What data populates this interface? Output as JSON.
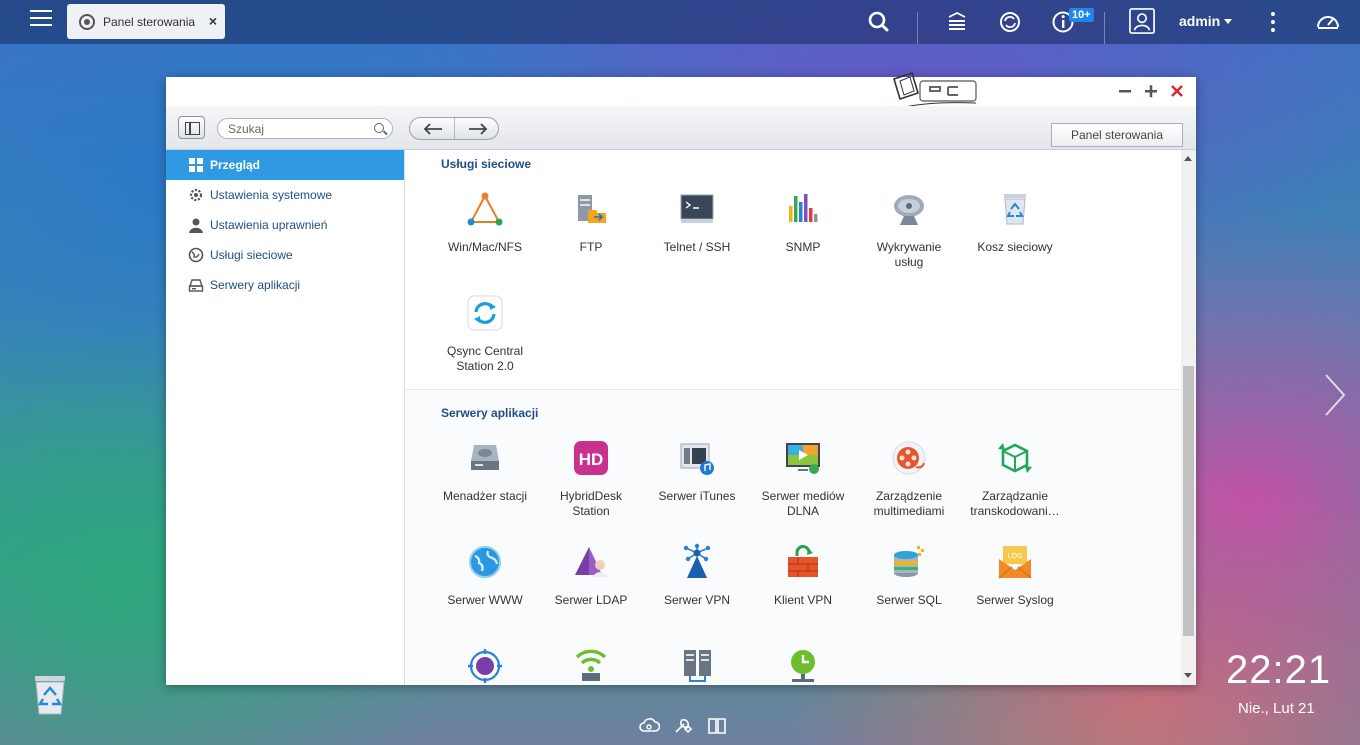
{
  "topbar": {
    "tab_title": "Panel sterowania",
    "notification_badge": "10+",
    "user": "admin"
  },
  "window": {
    "search_placeholder": "Szukaj",
    "breadcrumb": "Panel sterowania"
  },
  "sidebar": {
    "items": [
      {
        "label": "Przegląd",
        "icon": "grid-icon",
        "active": true
      },
      {
        "label": "Ustawienia systemowe",
        "icon": "gear-icon",
        "active": false
      },
      {
        "label": "Ustawienia uprawnień",
        "icon": "user-icon",
        "active": false
      },
      {
        "label": "Usługi sieciowe",
        "icon": "globe-icon",
        "active": false
      },
      {
        "label": "Serwery aplikacji",
        "icon": "server-icon",
        "active": false
      }
    ]
  },
  "sections": [
    {
      "title": "Usługi sieciowe",
      "apps": [
        {
          "line1": "Win/Mac/NFS",
          "line2": "",
          "icon": "network-triangle-icon"
        },
        {
          "line1": "FTP",
          "line2": "",
          "icon": "ftp-icon"
        },
        {
          "line1": "Telnet / SSH",
          "line2": "",
          "icon": "terminal-icon"
        },
        {
          "line1": "SNMP",
          "line2": "",
          "icon": "bar-chart-icon"
        },
        {
          "line1": "Wykrywanie",
          "line2": "usług",
          "icon": "satellite-dish-icon"
        },
        {
          "line1": "Kosz sieciowy",
          "line2": "",
          "icon": "recycle-bin-icon"
        },
        {
          "line1": "Qsync Central",
          "line2": "Station 2.0",
          "icon": "sync-icon"
        }
      ]
    },
    {
      "title": "Serwery aplikacji",
      "apps": [
        {
          "line1": "Menadżer stacji",
          "line2": "",
          "icon": "station-manager-icon"
        },
        {
          "line1": "HybridDesk",
          "line2": "Station",
          "icon": "hd-station-icon"
        },
        {
          "line1": "Serwer iTunes",
          "line2": "",
          "icon": "itunes-server-icon"
        },
        {
          "line1": "Serwer mediów",
          "line2": "DLNA",
          "icon": "dlna-media-icon"
        },
        {
          "line1": "Zarządzenie",
          "line2": "multimediami",
          "icon": "multimedia-reel-icon"
        },
        {
          "line1": "Zarządzanie",
          "line2": "transkodowani…",
          "icon": "transcoding-cube-icon"
        },
        {
          "line1": "Serwer WWW",
          "line2": "",
          "icon": "web-globe-icon"
        },
        {
          "line1": "Serwer LDAP",
          "line2": "",
          "icon": "ldap-icon"
        },
        {
          "line1": "Serwer VPN",
          "line2": "",
          "icon": "vpn-server-icon"
        },
        {
          "line1": "Klient VPN",
          "line2": "",
          "icon": "vpn-client-icon"
        },
        {
          "line1": "Serwer SQL",
          "line2": "",
          "icon": "sql-database-icon"
        },
        {
          "line1": "Serwer Syslog",
          "line2": "",
          "icon": "syslog-envelope-icon"
        },
        {
          "line1": "",
          "line2": "",
          "icon": "antivirus-icon"
        },
        {
          "line1": "",
          "line2": "",
          "icon": "radius-wifi-icon"
        },
        {
          "line1": "",
          "line2": "",
          "icon": "server-rack-icon"
        },
        {
          "line1": "",
          "line2": "",
          "icon": "ntp-clock-icon"
        }
      ]
    }
  ],
  "desktop": {
    "time": "22:21",
    "date": "Nie., Lut 21"
  },
  "colors": {
    "accent": "#2f9ae3",
    "link": "#1f4e86",
    "close": "#d9262b"
  }
}
